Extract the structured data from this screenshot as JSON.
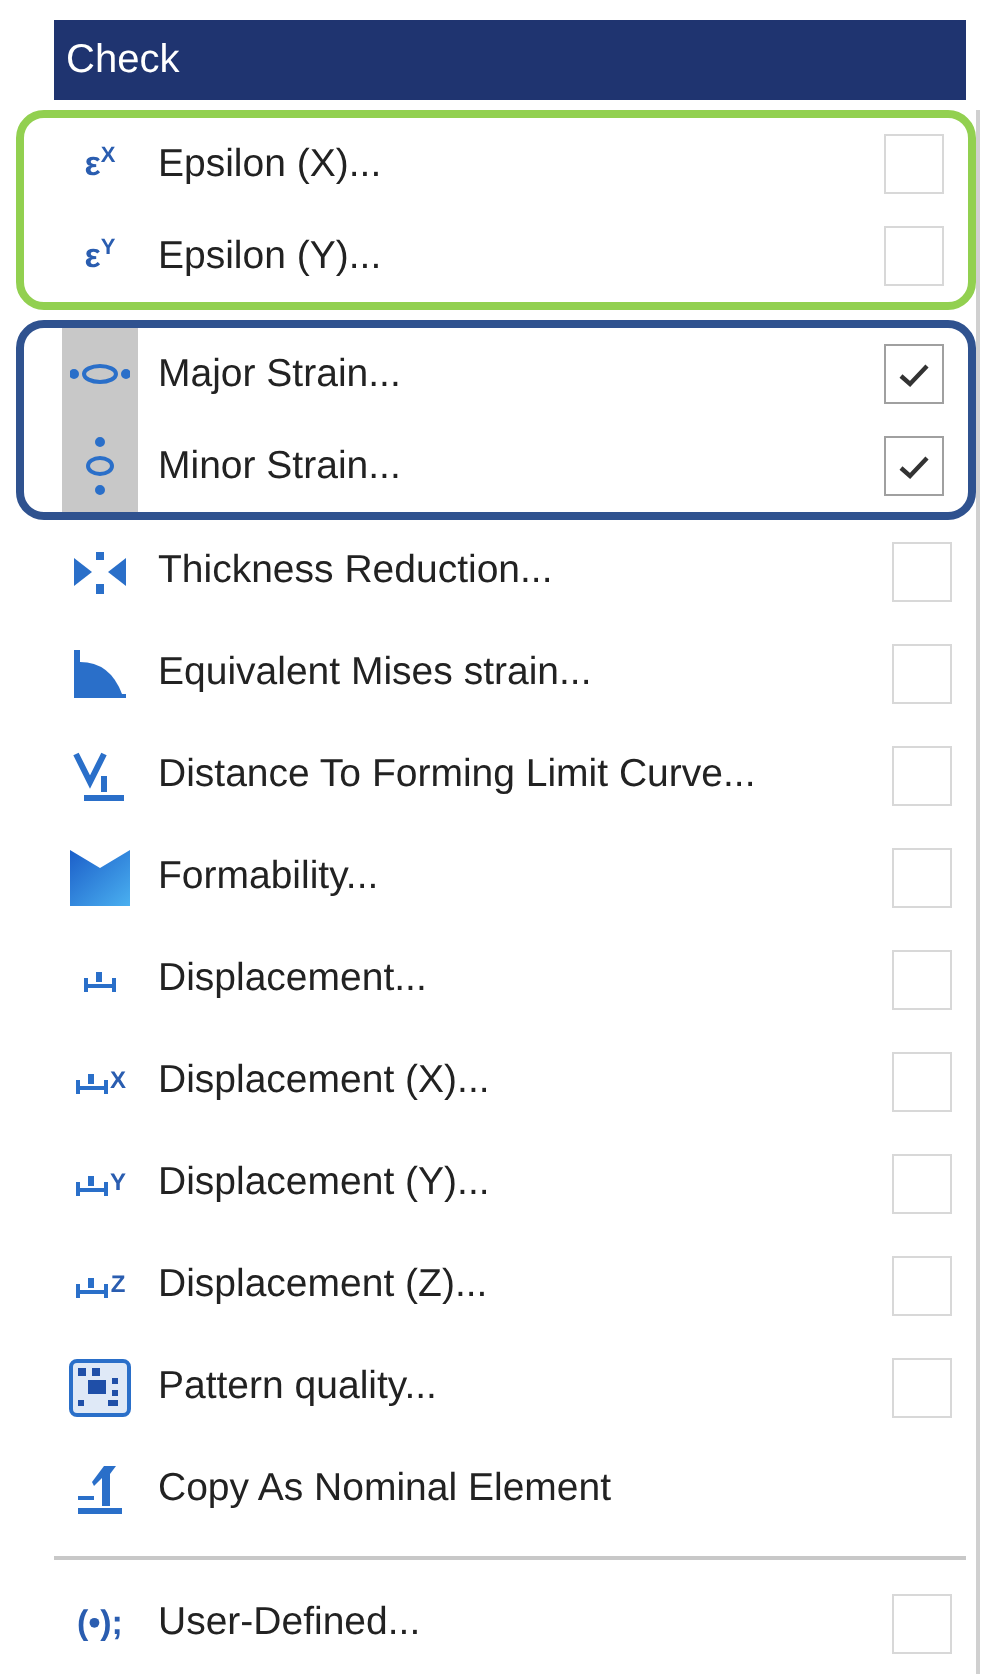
{
  "menu": {
    "title": "Check",
    "sections": [
      {
        "kind": "outlined",
        "color": "#92d050",
        "items": [
          {
            "kind": "toggle",
            "icon_text": "ε$^{X}$",
            "label": "Epsilon (X)...",
            "checked": false
          },
          {
            "kind": "toggle",
            "icon_text": "ε$^{Y}$",
            "label": "Epsilon (Y)...",
            "checked": false
          }
        ]
      },
      {
        "kind": "outlined",
        "color": "#2f528f",
        "items": [
          {
            "kind": "toggle",
            "label": "Major Strain...",
            "checked": true
          },
          {
            "kind": "toggle",
            "label": "Minor Strain...",
            "checked": true
          }
        ]
      },
      {
        "kind": "plain",
        "items": [
          {
            "kind": "toggle",
            "label": "Thickness Reduction...",
            "checked": false
          },
          {
            "kind": "toggle",
            "label": "Equivalent Mises strain...",
            "checked": false
          },
          {
            "kind": "toggle",
            "label": "Distance To Forming Limit Curve...",
            "checked": false
          },
          {
            "kind": "toggle",
            "label": "Formability...",
            "checked": false
          },
          {
            "kind": "toggle",
            "label": "Displacement...",
            "checked": false
          },
          {
            "kind": "toggle",
            "icon_text": "X",
            "label": "Displacement (X)...",
            "checked": false
          },
          {
            "kind": "toggle",
            "icon_text": "Y",
            "label": "Displacement (Y)...",
            "checked": false
          },
          {
            "kind": "toggle",
            "icon_text": "Z",
            "label": "Displacement (Z)...",
            "checked": false
          },
          {
            "kind": "toggle",
            "label": "Pattern quality...",
            "checked": false
          },
          {
            "kind": "command",
            "label": "Copy As Nominal Element"
          }
        ]
      },
      {
        "kind": "separated",
        "items": [
          {
            "kind": "toggle",
            "icon_text": "(•);",
            "label": "User-Defined...",
            "checked": false
          }
        ]
      }
    ]
  }
}
